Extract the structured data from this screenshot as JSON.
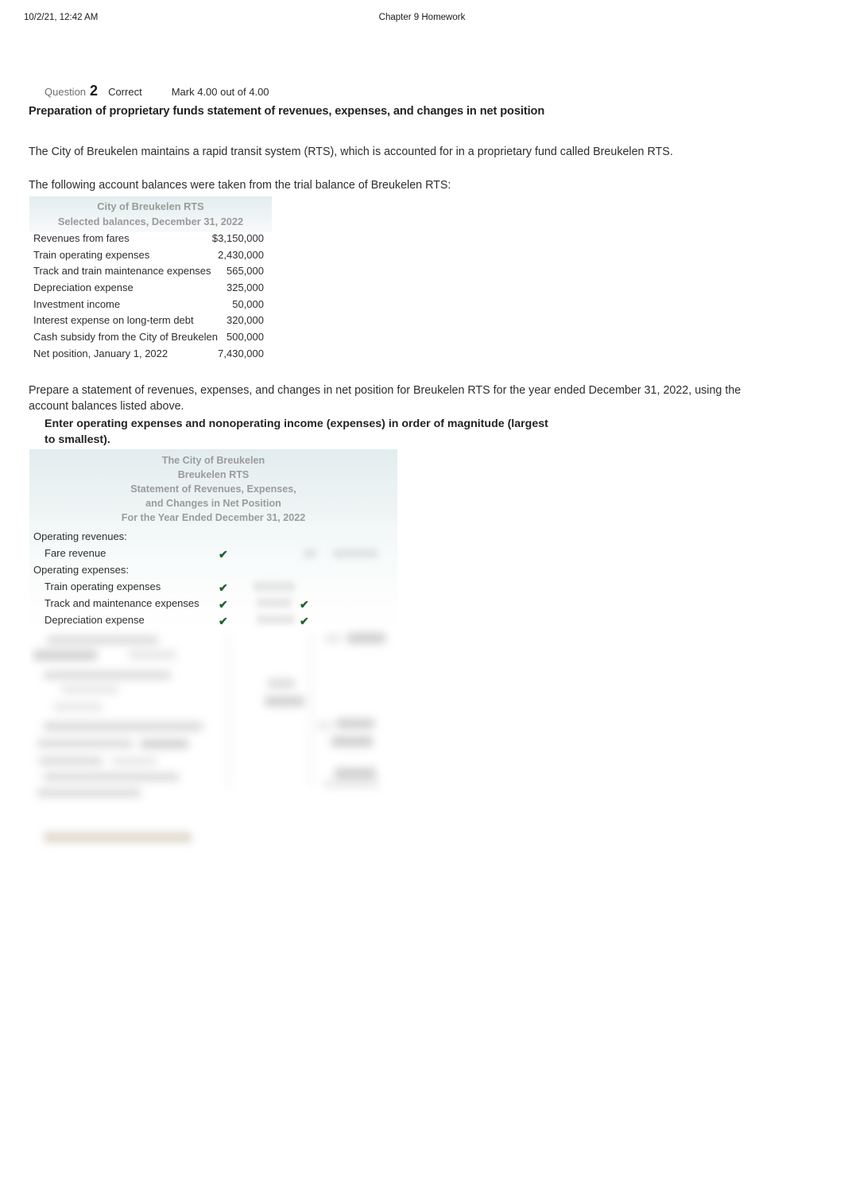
{
  "print_header": {
    "timestamp": "10/2/21, 12:42 AM",
    "document_title": "Chapter 9 Homework"
  },
  "question": {
    "label": "Question",
    "number": "2",
    "state": "Correct",
    "mark": "Mark 4.00 out of 4.00",
    "title": "Preparation of proprietary funds statement of revenues, expenses, and changes in net position",
    "intro_paragraph": "The City of Breukelen maintains a rapid transit system (RTS), which is accounted for in a proprietary fund called Breukelen RTS.",
    "trial_balance_lead_in": "The following account balances were taken from the trial balance of Breukelen RTS:",
    "prepare_paragraph": "Prepare a statement of revenues, expenses, and changes in net position for Breukelen RTS for the year ended December 31, 2022, using the account balances listed above.",
    "instruction": "Enter operating expenses and nonoperating income (expenses) in order of magnitude (largest to smallest)."
  },
  "trial_balance": {
    "header_lines": [
      "City of Breukelen RTS",
      "Selected balances, December 31, 2022"
    ],
    "rows": [
      {
        "label": "Revenues from fares",
        "amount": "$3,150,000"
      },
      {
        "label": "Train operating expenses",
        "amount": "2,430,000"
      },
      {
        "label": "Track and train maintenance expenses",
        "amount": "565,000"
      },
      {
        "label": "Depreciation expense",
        "amount": "325,000"
      },
      {
        "label": "Investment income",
        "amount": "50,000"
      },
      {
        "label": "Interest expense on long-term debt",
        "amount": "320,000"
      },
      {
        "label": "Cash subsidy from the City of Breukelen",
        "amount": "500,000"
      },
      {
        "label": "Net position, January 1, 2022",
        "amount": "7,430,000"
      }
    ]
  },
  "answer_table": {
    "header_lines": [
      "The City of Breukelen",
      "Breukelen RTS",
      "Statement of Revenues, Expenses,",
      "and Changes in Net Position",
      "For the Year Ended December 31, 2022"
    ],
    "rows": [
      {
        "label": "Operating revenues:",
        "indent": false,
        "check_col1": "",
        "check_col2": ""
      },
      {
        "label": "Fare revenue",
        "indent": true,
        "check_col1": "✔",
        "check_col2": ""
      },
      {
        "label": "Operating expenses:",
        "indent": false,
        "check_col1": "",
        "check_col2": ""
      },
      {
        "label": "Train operating expenses",
        "indent": true,
        "check_col1": "✔",
        "check_col2": ""
      },
      {
        "label": "Track and maintenance expenses",
        "indent": true,
        "check_col1": "✔",
        "check_col2": "✔"
      },
      {
        "label": "Depreciation expense",
        "indent": true,
        "check_col1": "✔",
        "check_col2": "✔"
      }
    ]
  },
  "colors": {
    "check_green": "#1f6230",
    "table_header_tint": "#e4edef",
    "answer_body_tint": "#f2f7f8",
    "body_text": "#2e2e2e",
    "muted_header_text": "#9a9a9a",
    "feedback_bar": "#c9bfa8"
  }
}
